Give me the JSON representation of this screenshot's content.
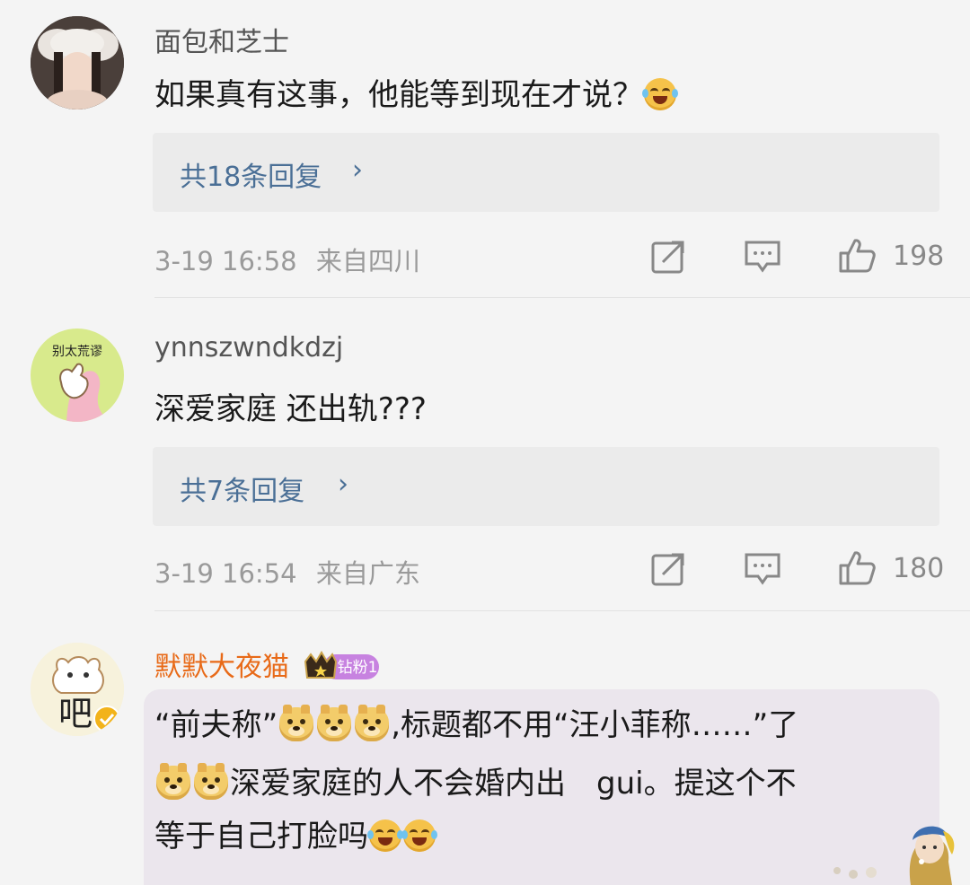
{
  "comments": [
    {
      "username": "面包和芝士",
      "text": "如果真有这事，他能等到现在才说？",
      "replies": "共18条回复",
      "time": "3-19 16:58",
      "location": "来自四川",
      "likes": "198"
    },
    {
      "username": "ynnszwndkdzj",
      "avatar_text": "别太荒谬",
      "text": "深爱家庭 还出轨???",
      "replies": "共7条回复",
      "time": "3-19 16:54",
      "location": "来自广东",
      "likes": "180"
    },
    {
      "username": "默默大夜猫",
      "badge": "钻粉1",
      "avatar_text": "吧",
      "line1a": "“前夫称”",
      "line1b": ",标题都不用“汪小菲称……”了",
      "line2": "深爱家庭的人不会婚内出　gui。提这个不",
      "line3": "等于自己打脸吗"
    }
  ],
  "icons": {
    "chevron": "›"
  },
  "colors": {
    "reply_link": "#4a6f96",
    "vip_name": "#e86a18",
    "badge": "#c782e0"
  }
}
